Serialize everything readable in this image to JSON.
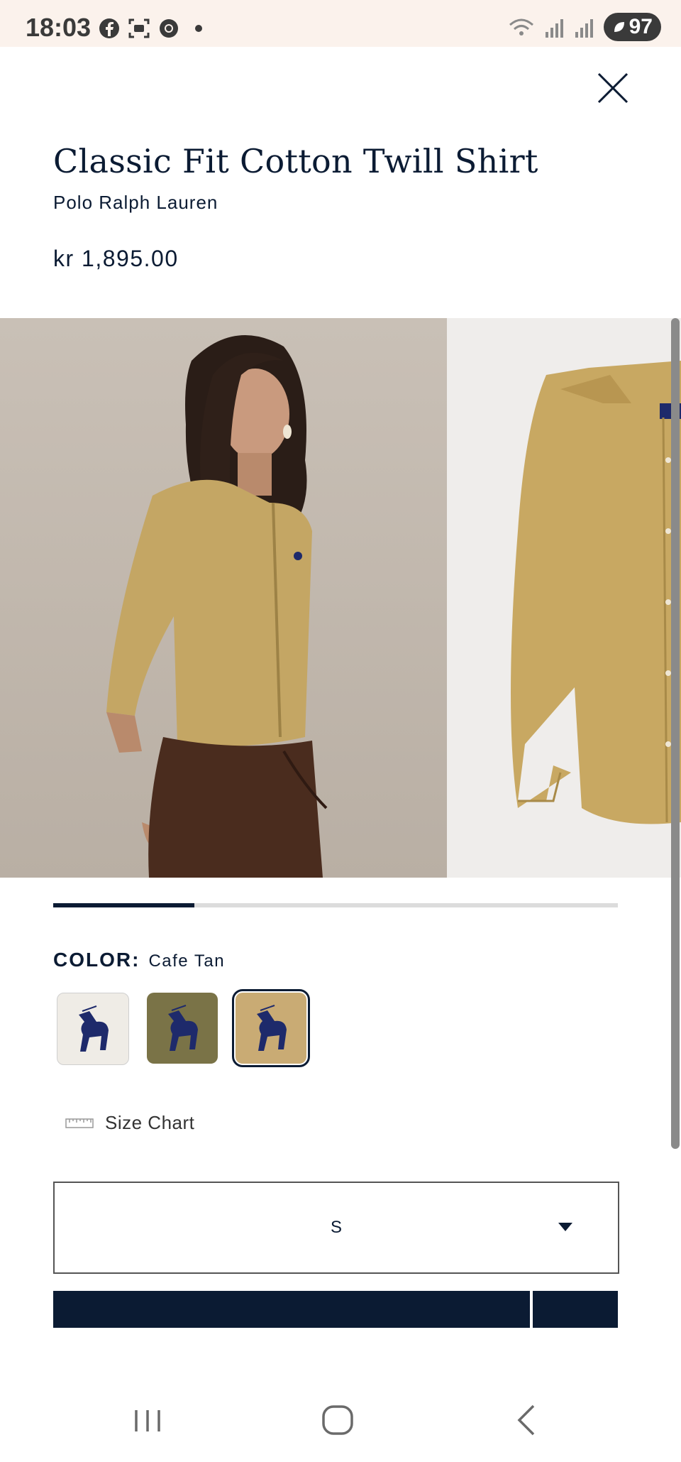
{
  "status_bar": {
    "time": "18:03",
    "battery": "97",
    "icons": [
      "facebook-icon",
      "screenshot-icon",
      "chrome-icon",
      "dot-icon",
      "wifi-icon",
      "signal-icon",
      "signal-r-icon",
      "battery-icon"
    ]
  },
  "product": {
    "title": "Classic Fit Cotton Twill Shirt",
    "brand": "Polo Ralph Lauren",
    "price": "kr 1,895.00"
  },
  "gallery": {
    "images": [
      "model-wearing-shirt",
      "shirt-flat-front"
    ],
    "progress_fraction": 0.25
  },
  "color": {
    "label": "COLOR:",
    "selected": "Cafe Tan",
    "swatches": [
      {
        "name": "white",
        "color": "#efece6"
      },
      {
        "name": "olive",
        "color": "#7a7347"
      },
      {
        "name": "cafe-tan",
        "color": "#c9ab74",
        "selected": true
      }
    ],
    "logo_color": "#1e2a6b"
  },
  "size_chart": {
    "label": "Size Chart"
  },
  "size_select": {
    "value": "S"
  },
  "colors": {
    "navy": "#0b1b33",
    "shirt": "#c4a664"
  }
}
